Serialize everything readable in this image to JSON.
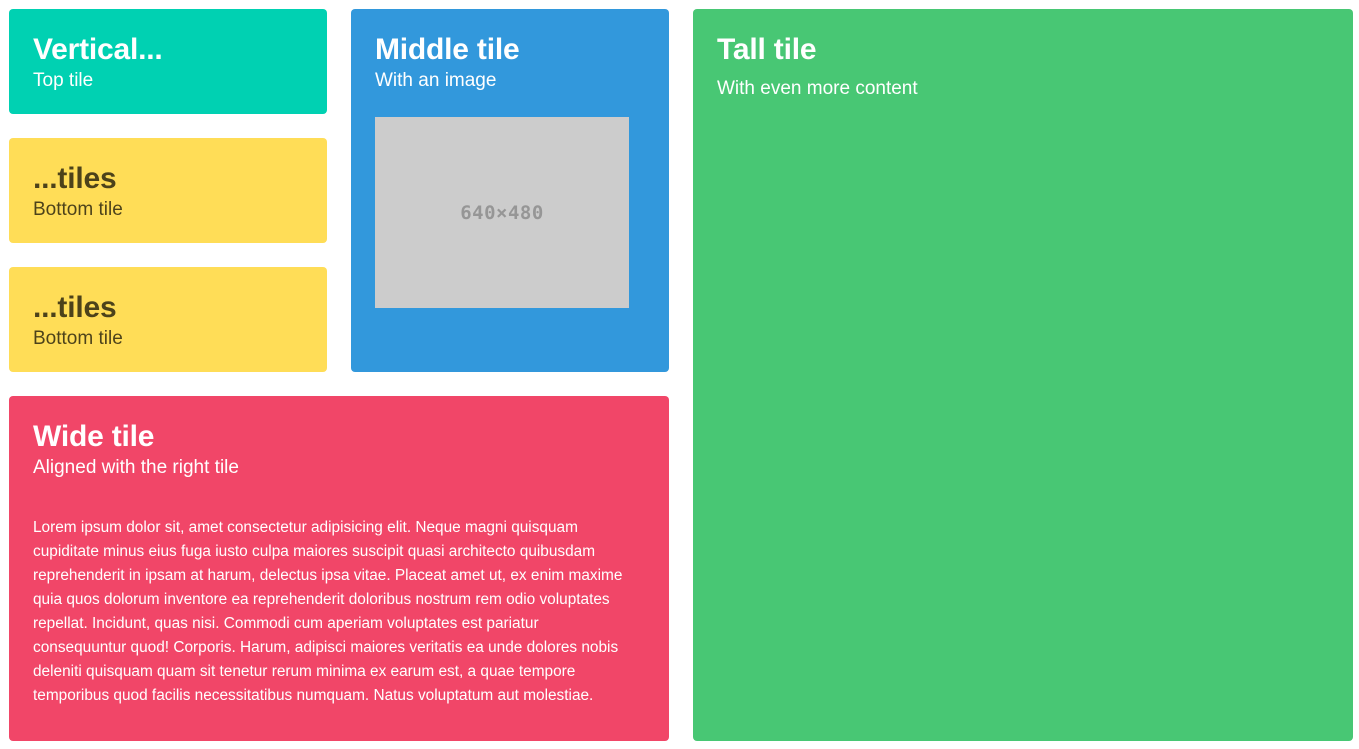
{
  "tiles": {
    "top": {
      "title": "Vertical...",
      "subtitle": "Top tile",
      "color": "#00d1b2"
    },
    "bottom1": {
      "title": "...tiles",
      "subtitle": "Bottom tile",
      "color": "#ffdd57"
    },
    "bottom2": {
      "title": "...tiles",
      "subtitle": "Bottom tile",
      "color": "#ffdd57"
    },
    "middle": {
      "title": "Middle tile",
      "subtitle": "With an image",
      "image_label": "640×480",
      "color": "#3298dc"
    },
    "tall": {
      "title": "Tall tile",
      "subtitle": "With even more content",
      "color": "#48c774"
    },
    "wide": {
      "title": "Wide tile",
      "subtitle": "Aligned with the right tile",
      "body": "Lorem ipsum dolor sit, amet consectetur adipisicing elit. Neque magni quisquam cupiditate minus eius fuga iusto culpa maiores suscipit quasi architecto quibusdam reprehenderit in ipsam at harum, delectus ipsa vitae. Placeat amet ut, ex enim maxime quia quos dolorum inventore ea reprehenderit doloribus nostrum rem odio voluptates repellat. Incidunt, quas nisi. Commodi cum aperiam voluptates est pariatur consequuntur quod! Corporis. Harum, adipisci maiores veritatis ea unde dolores nobis deleniti quisquam quam sit tenetur rerum minima ex earum est, a quae tempore temporibus quod facilis necessitatibus numquam. Natus voluptatum aut molestiae.",
      "color": "#f14668"
    }
  }
}
